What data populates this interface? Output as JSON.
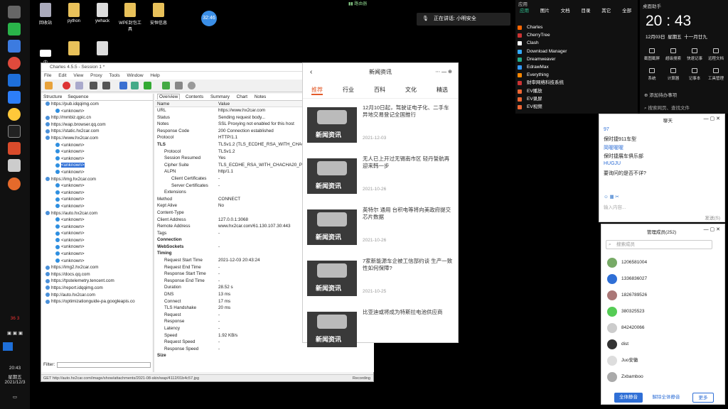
{
  "taskbar": {
    "time": "20:43",
    "weekday": "星期五",
    "date": "2021/12/3",
    "tray_nums": [
      "36",
      "3"
    ]
  },
  "desktop": {
    "icons": [
      "回收站",
      "python",
      "ywhack",
      "WPE封包工具",
      "安恒信息",
      "内"
    ],
    "clock_bubble": "32:46",
    "top_status": "路由器"
  },
  "charles": {
    "title": "Charles 4.5.5 - Session 1 *",
    "menu": [
      "File",
      "Edit",
      "View",
      "Proxy",
      "Tools",
      "Window",
      "Help"
    ],
    "left_tabs": [
      "Structure",
      "Sequence"
    ],
    "tree": [
      "https://pub.idqqimg.com",
      "<unknown>",
      "http://mmbiz.qpic.cn",
      "https://wap.browser.qq.com",
      "https://static.hx2car.com",
      "https://www.hx2car.com",
      "<unknown>",
      "<unknown>",
      "<unknown>",
      "<unknown>",
      "<unknown>",
      "https://img.hx2car.com",
      "<unknown>",
      "<unknown>",
      "<unknown>",
      "<unknown>",
      "https://auto.hx2car.com",
      "<unknown>",
      "<unknown>",
      "<unknown>",
      "<unknown>",
      "<unknown>",
      "<unknown>",
      "<unknown>",
      "https://img2.hx2car.com",
      "https://docs.qq.com",
      "https://tpstelemetry.tencent.com",
      "https://report.idqqimg.com",
      "http://auto.hx2car.com",
      "https://optimizationguide-pa.googleapis.co"
    ],
    "selected_index": 9,
    "right_tabs": [
      "Overview",
      "Contents",
      "Summary",
      "Chart",
      "Notes"
    ],
    "col_name": "Name",
    "col_value": "Value",
    "rows": [
      {
        "n": "URL",
        "v": "https://www.hx2car.com"
      },
      {
        "n": "Status",
        "v": "Sending request body..."
      },
      {
        "n": "Notes",
        "v": "SSL Proxying not enabled for this host"
      },
      {
        "n": "Response Code",
        "v": "200 Connection established"
      },
      {
        "n": "Protocol",
        "v": "HTTP/1.1"
      },
      {
        "n": "TLS",
        "v": "TLSv1.2 (TLS_ECDHE_RSA_WITH_CHACHA"
      },
      {
        "n": "Protocol",
        "v": "TLSv1.2"
      },
      {
        "n": "Session Resumed",
        "v": "Yes"
      },
      {
        "n": "Cipher Suite",
        "v": "TLS_ECDHE_RSA_WITH_CHACHA20_PO"
      },
      {
        "n": "ALPN",
        "v": "http/1.1"
      },
      {
        "n": "Client Certificates",
        "v": "-"
      },
      {
        "n": "Server Certificates",
        "v": "-"
      },
      {
        "n": "Extensions",
        "v": ""
      },
      {
        "n": "Method",
        "v": "CONNECT"
      },
      {
        "n": "Kept Alive",
        "v": "No"
      },
      {
        "n": "Content-Type",
        "v": ""
      },
      {
        "n": "Client Address",
        "v": "127.0.0.1:3068"
      },
      {
        "n": "Remote Address",
        "v": "www.hx2car.com/61.130.107.30:443"
      },
      {
        "n": "Tags",
        "v": "-"
      },
      {
        "n": "Connection",
        "v": ""
      },
      {
        "n": "WebSockets",
        "v": "-"
      },
      {
        "n": "Timing",
        "v": ""
      },
      {
        "n": "Request Start Time",
        "v": "2021-12-03 20:43:24"
      },
      {
        "n": "Request End Time",
        "v": "-"
      },
      {
        "n": "Response Start Time",
        "v": "-"
      },
      {
        "n": "Response End Time",
        "v": "-"
      },
      {
        "n": "Duration",
        "v": "28.52 s"
      },
      {
        "n": "DNS",
        "v": "13 ms"
      },
      {
        "n": "Connect",
        "v": "17 ms"
      },
      {
        "n": "TLS Handshake",
        "v": "20 ms"
      },
      {
        "n": "Request",
        "v": "-"
      },
      {
        "n": "Response",
        "v": "-"
      },
      {
        "n": "Latency",
        "v": "-"
      },
      {
        "n": "Speed",
        "v": "1.92 KB/s"
      },
      {
        "n": "Request Speed",
        "v": "-"
      },
      {
        "n": "Response Speed",
        "v": "-"
      },
      {
        "n": "Size",
        "v": ""
      }
    ],
    "filter_label": "Filter:",
    "status_url": "GET http://auto.hx2car.com/image/show/attachments/2021-08-skin/wap/4112/01b4c57.jpg",
    "status_right": "Recording"
  },
  "news": {
    "title": "新闻资讯",
    "cats": [
      "推荐",
      "行业",
      "百科",
      "文化",
      "精选"
    ],
    "thumb_label": "新闻资讯",
    "items": [
      {
        "title": "12月10日起，驾驶证电子化、二手车异地交易登记全国推行",
        "date": "2021-12-03"
      },
      {
        "title": "无人已上开过无锡南市区 轻丹誓航再迎来韩一步",
        "date": "2021-10-26"
      },
      {
        "title": "英特尔 通用 台积电等将向美政府提交芯片数据",
        "date": "2021-10-26"
      },
      {
        "title": "7家新能源车企被工信部约谈 生产一致性如何保障?",
        "date": "2021-10-25"
      },
      {
        "title": "比亚迪或将成为特斯拉电池供应商",
        "date": ""
      }
    ]
  },
  "voice": {
    "label": "正在讲话: 小明安全"
  },
  "apps": {
    "tabs": [
      "应用",
      "图片",
      "文档",
      "目录",
      "其它",
      "全部"
    ],
    "header": "应用",
    "items": [
      "Charles",
      "CherryTree",
      "Clash",
      "Download Manager",
      "Dreamweaver",
      "EdrawMax",
      "Everything",
      "财审网络科技系统",
      "EV播放",
      "EV录屏",
      "EV视频"
    ]
  },
  "helper": {
    "title": "桌面助手",
    "time": "20 : 43",
    "date": "12月03日",
    "weekday": "星期五",
    "lunar": "十一月廿九",
    "buttons": [
      "截图截屏",
      "超级搜索",
      "快速记事",
      "远程文档",
      "系统",
      "计算器",
      "记事本",
      "工具管理"
    ],
    "todo": "添加待办事项",
    "search": "搜索网页、查找文件"
  },
  "chat": {
    "title": "聊天",
    "lines": [
      "97",
      "保时捷911车型",
      "简喔喔喔",
      "保时捷展车俱乐部",
      "HUGJU",
      "要询问的是否不详?"
    ],
    "send_label": "发送(S)",
    "input_placeholder": "输入内容..."
  },
  "group": {
    "title": "管理成员(252)",
    "search_placeholder": "搜索成员",
    "members": [
      "1206581004",
      "1336836027",
      "1826789526",
      "380325523",
      "842420066",
      "dist",
      "Juo安徽",
      "Zxbamboo"
    ],
    "btn_all_mute": "全体静音",
    "btn_unmute": "解除全体静音",
    "btn_more": "更多"
  },
  "colors": {
    "accent": "#2f6fd6",
    "news_red": "#e35b2a"
  }
}
